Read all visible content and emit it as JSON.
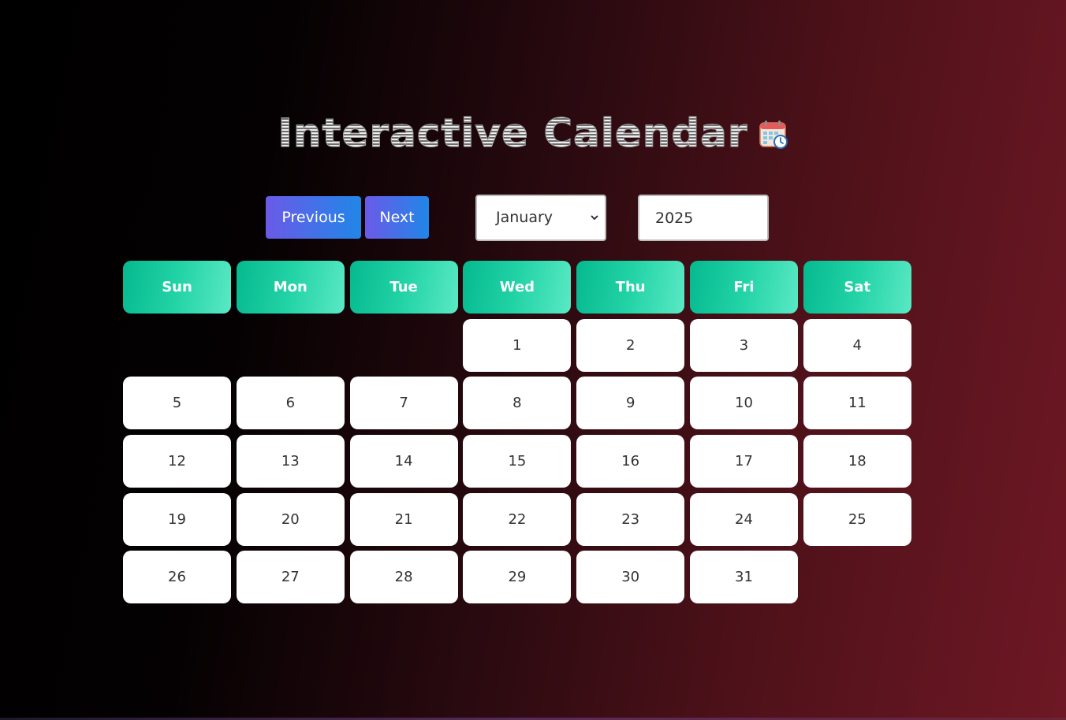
{
  "title": {
    "text": "Interactive Calendar",
    "icon": "calendar-clock-icon"
  },
  "controls": {
    "previous_label": "Previous",
    "next_label": "Next",
    "month_selected": "January",
    "year_value": "2025"
  },
  "weekdays": [
    "Sun",
    "Mon",
    "Tue",
    "Wed",
    "Thu",
    "Fri",
    "Sat"
  ],
  "calendar": {
    "leading_blanks": 3,
    "days": [
      "1",
      "2",
      "3",
      "4",
      "5",
      "6",
      "7",
      "8",
      "9",
      "10",
      "11",
      "12",
      "13",
      "14",
      "15",
      "16",
      "17",
      "18",
      "19",
      "20",
      "21",
      "22",
      "23",
      "24",
      "25",
      "26",
      "27",
      "28",
      "29",
      "30",
      "31"
    ]
  },
  "colors": {
    "header_gradient": [
      "#05b98f",
      "#5ae9c4"
    ],
    "button_gradient": [
      "#6a5ae8",
      "#2186e8"
    ],
    "background_gradient": [
      "#000000",
      "#6e1824"
    ]
  }
}
